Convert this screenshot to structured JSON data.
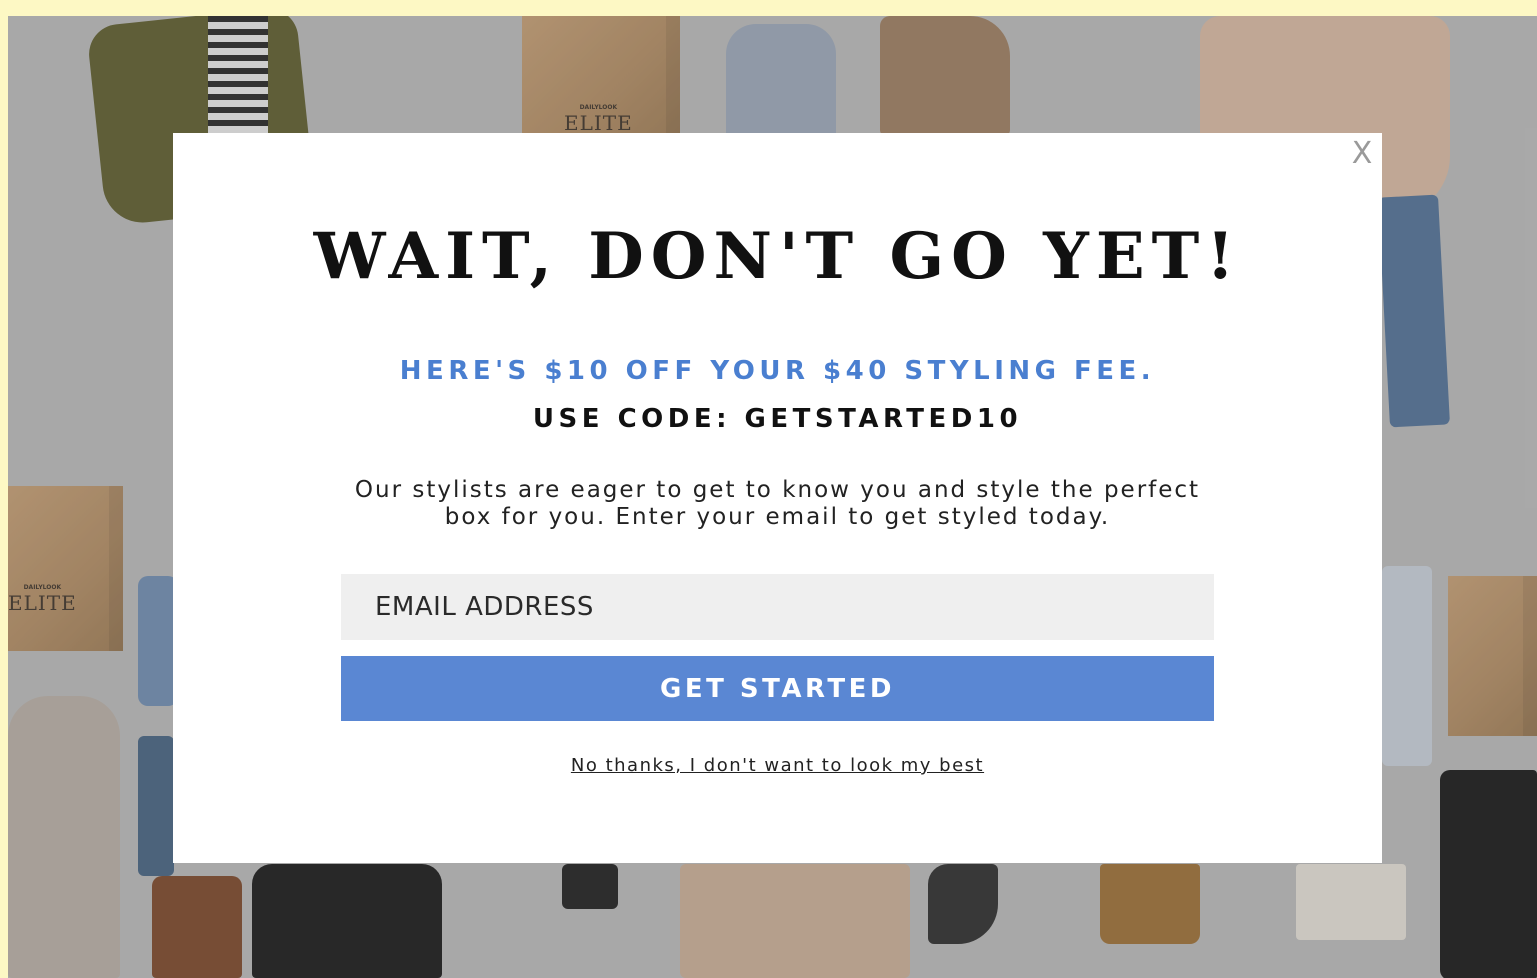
{
  "background": {
    "box_label_small": "DAILYLOOK",
    "box_label_brand": "ELITE"
  },
  "modal": {
    "close_label": "X",
    "title": "WAIT, DON'T GO YET!",
    "offer_text": "HERE'S $10 OFF YOUR $40 STYLING FEE.",
    "code_text": "USE CODE: GETSTARTED10",
    "description": "Our stylists are eager to get to know you and style the perfect box for you. Enter your email to get styled today.",
    "email_placeholder": "EMAIL ADDRESS",
    "email_value": "",
    "submit_label": "GET STARTED",
    "decline_label": "No thanks, I don't want to look my best"
  },
  "colors": {
    "accent_blue_text": "#4a7fd0",
    "button_blue": "#5a87d3",
    "page_border": "#fdf8c4"
  }
}
